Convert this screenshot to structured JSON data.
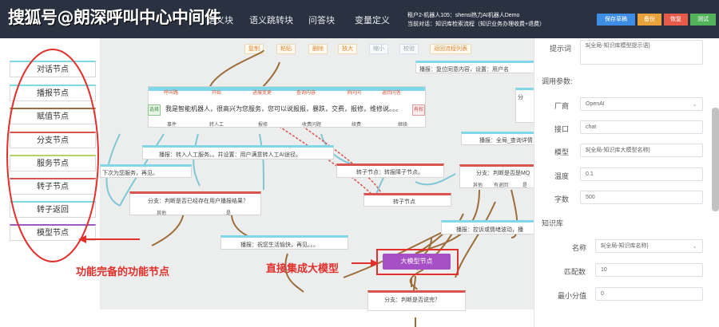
{
  "watermark": "搜狐号@朗深呼叫中心中间件",
  "nav": {
    "tabs": [
      {
        "label": "语义块"
      },
      {
        "label": "语义跳转块"
      },
      {
        "label": "问答块"
      },
      {
        "label": "变量定义"
      }
    ]
  },
  "context": {
    "line1": "租户2-机器人105：shensi热力AI机器人Demo",
    "line2": "当前对话：知识库检索流程（知识业务办理收费+退费）"
  },
  "top_buttons": {
    "save_publish": "保存草稿",
    "backup": "备份",
    "restore": "恢复",
    "test": "测试"
  },
  "toolbar": {
    "copy": "复制",
    "paste": "粘贴",
    "delete": "删除",
    "zoom_in": "放大",
    "zoom_out": "缩小",
    "validate": "校验",
    "return_list": "返回流程列表"
  },
  "sidebar": {
    "items": [
      {
        "label": "对话节点"
      },
      {
        "label": "播报节点"
      },
      {
        "label": "赋值节点"
      },
      {
        "label": "分支节点"
      },
      {
        "label": "服务节点"
      },
      {
        "label": "转子节点"
      },
      {
        "label": "转子返回"
      },
      {
        "label": "模型节点"
      }
    ]
  },
  "canvas": {
    "top_broadcast": "播报：复位同意内容，设置：用户名",
    "dialog_tags": [
      "呼叫路",
      "开始",
      "进展变更",
      "查询内容",
      "询问问",
      "返回问答"
    ],
    "dialog_text": "我是智能机器人，很高兴为您服务，您可以说报报，暴跌，交费，报修，维修说。。。",
    "dialog_bottom_tags": [
      "事件",
      "转人工",
      "报修",
      "收费问题",
      "续费",
      "继续"
    ],
    "left_broadcast": "播报：转入人工服务。。并设置：用户满意转人工AI途径。",
    "left_text": "下次为您服务，再见。",
    "branch1": "分支：判断是否已经存在用户播报结果？",
    "branch1_opts": [
      "其他",
      "是"
    ],
    "subflow": "转子节点：转报障子节点。",
    "subflow2": "转子节点",
    "right_broadcast": "播报：全局_查询详情",
    "right_branch": "分支：判断是否是MQ",
    "right_branch_opts": [
      "其他",
      "有退回",
      "是"
    ],
    "mid_broadcast": "播报：祝您生活愉快，再见。。。",
    "low_broadcast": "播报：控诉或情绪波动，播",
    "llm_node": "大模型节点",
    "bottom_branch": "分支：判断是否说完？",
    "right_hidden": "分",
    "branch_pill_left": "选择",
    "branch_pill_right": "有权"
  },
  "annotations": {
    "left": "功能完备的功能节点",
    "right": "直接集成大模型"
  },
  "panel": {
    "prompt_label": "提示词",
    "prompt_value": "${全局-知识库模型提示语}",
    "call_params_label": "调用参数:",
    "vendor_label": "厂商",
    "vendor_value": "OpenAI",
    "api_label": "接口",
    "api_value": "chat",
    "model_label": "模型",
    "model_value": "${全局-知识库大模型名称}",
    "temperature_label": "温度",
    "temperature_value": "0.1",
    "tokens_label": "字数",
    "tokens_value": "500",
    "kb_label": "知识库",
    "name_label": "名称",
    "name_value": "${全局-知识库名称}",
    "match_label": "匹配数",
    "match_value": "10",
    "min_score_label": "最小分值",
    "min_score_value": "0"
  }
}
